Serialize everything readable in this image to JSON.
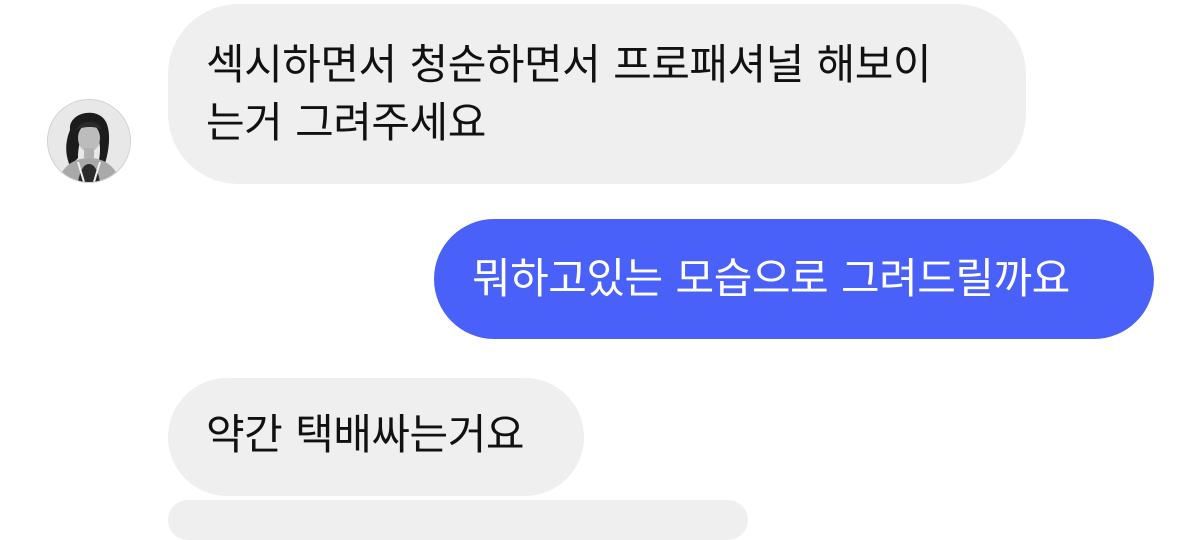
{
  "chat": {
    "messages": [
      {
        "sender": "other",
        "lines": [
          "섹시하면서 청순하면서 프로패셔널 해보이",
          "는거 그려주세요"
        ]
      },
      {
        "sender": "me",
        "text": "뭐하고있는 모습으로 그려드릴까요"
      },
      {
        "sender": "other",
        "text": "약간 택배싸는거요"
      }
    ]
  },
  "colors": {
    "incoming_bubble": "#efefef",
    "outgoing_bubble": "#4a61f9",
    "incoming_text": "#111111",
    "outgoing_text": "#ffffff"
  },
  "avatar": {
    "icon": "profile-photo-avatar"
  }
}
